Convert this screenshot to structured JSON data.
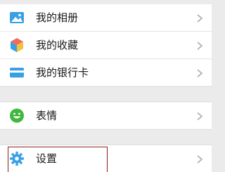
{
  "menu": {
    "group1": [
      {
        "label": "我的相册",
        "icon": "photo-album-icon",
        "icon_color": "#3aa0e6"
      },
      {
        "label": "我的收藏",
        "icon": "favorites-cube-icon",
        "icon_color": "#f2a33a"
      },
      {
        "label": "我的银行卡",
        "icon": "bank-card-icon",
        "icon_color": "#3aa0e6"
      }
    ],
    "group2": [
      {
        "label": "表情",
        "icon": "emoji-smile-icon",
        "icon_color": "#3fb83f"
      }
    ],
    "group3": [
      {
        "label": "设置",
        "icon": "settings-gear-icon",
        "icon_color": "#3aa0e6"
      }
    ]
  },
  "colors": {
    "background": "#ebebeb",
    "row_background": "#ffffff",
    "chevron": "#b5b5b5",
    "highlight_border": "#8b1e1e"
  }
}
